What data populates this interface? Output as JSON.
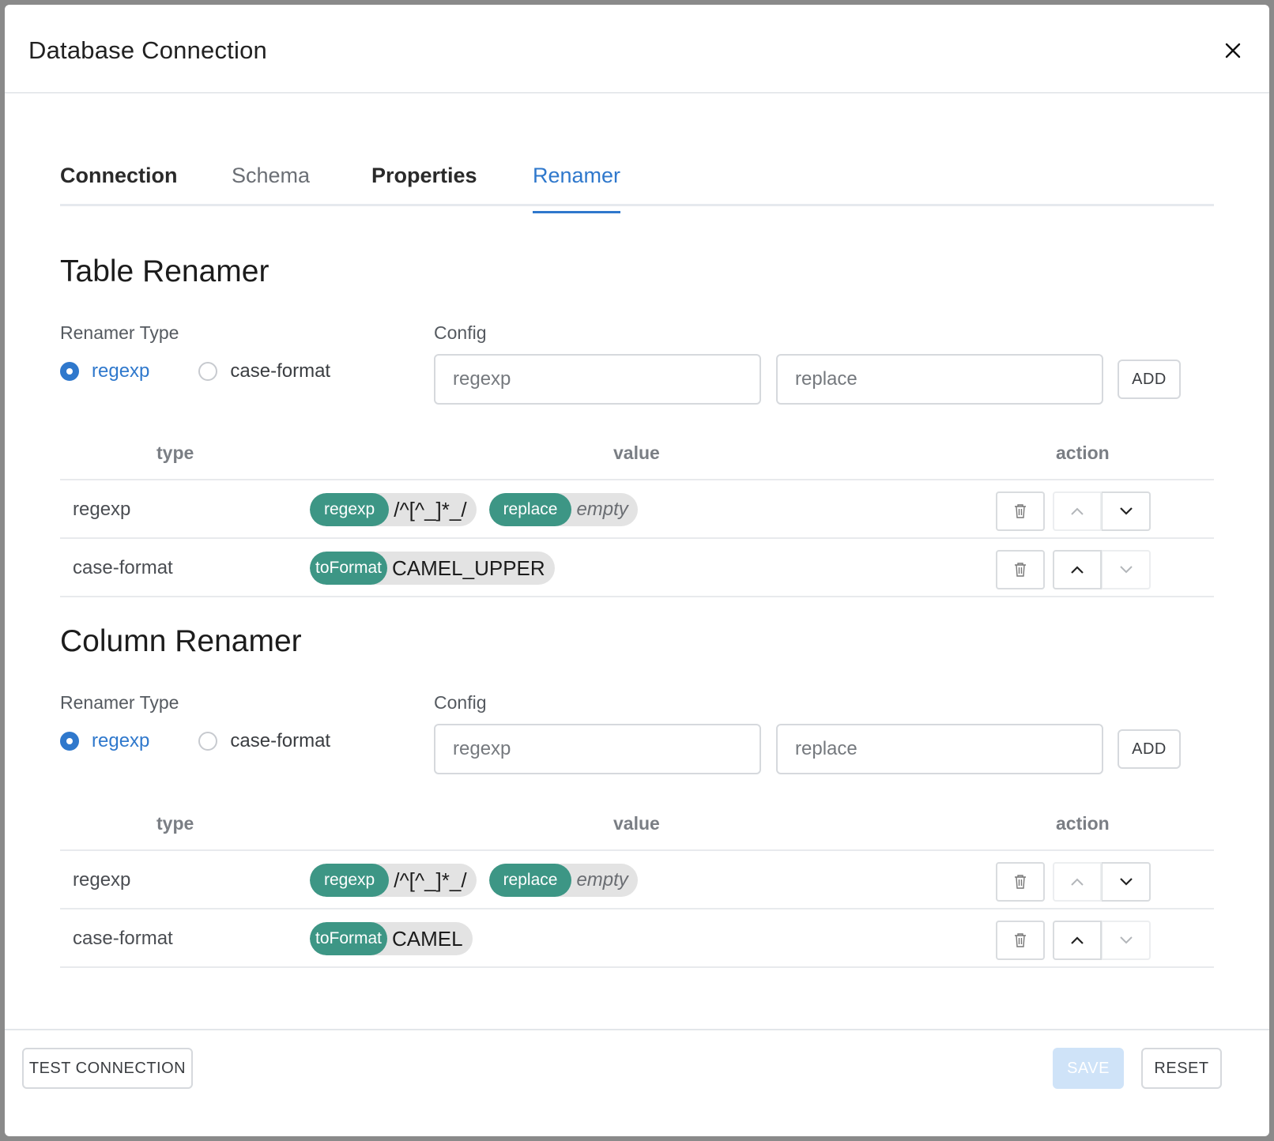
{
  "dialog": {
    "title": "Database Connection",
    "close_icon": "close-icon"
  },
  "tabs": [
    {
      "label": "Connection"
    },
    {
      "label": "Schema"
    },
    {
      "label": "Properties"
    },
    {
      "label": "Renamer"
    }
  ],
  "active_tab": "Renamer",
  "table_renamer": {
    "title": "Table Renamer",
    "renamer_type_label": "Renamer Type",
    "config_label": "Config",
    "radio_options": [
      "regexp",
      "case-format"
    ],
    "selected": "regexp",
    "regexp_placeholder": "regexp",
    "replace_placeholder": "replace",
    "add_label": "ADD",
    "columns": {
      "type": "type",
      "value": "value",
      "action": "action"
    },
    "rows": [
      {
        "type": "regexp",
        "chips": [
          {
            "key": "regexp",
            "value": "/^[^_]*_/"
          },
          {
            "key": "replace",
            "value": "empty"
          }
        ]
      },
      {
        "type": "case-format",
        "chips": [
          {
            "key": "toFormat",
            "value": "CAMEL_UPPER"
          }
        ]
      }
    ]
  },
  "column_renamer": {
    "title": "Column Renamer",
    "renamer_type_label": "Renamer Type",
    "config_label": "Config",
    "radio_options": [
      "regexp",
      "case-format"
    ],
    "selected": "regexp",
    "regexp_placeholder": "regexp",
    "replace_placeholder": "replace",
    "add_label": "ADD",
    "columns": {
      "type": "type",
      "value": "value",
      "action": "action"
    },
    "rows": [
      {
        "type": "regexp",
        "chips": [
          {
            "key": "regexp",
            "value": "/^[^_]*_/"
          },
          {
            "key": "replace",
            "value": "empty"
          }
        ]
      },
      {
        "type": "case-format",
        "chips": [
          {
            "key": "toFormat",
            "value": "CAMEL"
          }
        ]
      }
    ]
  },
  "footer": {
    "test_connection_label": "TEST CONNECTION",
    "save_label": "SAVE",
    "reset_label": "RESET"
  },
  "colors": {
    "accent": "#2f78cc",
    "chip_key": "#3d9685",
    "chip_bg": "#e3e3e3",
    "save_disabled": "#cfe3f8"
  },
  "icons": {
    "delete": "trash-icon",
    "up": "chevron-up-icon",
    "down": "chevron-down-icon"
  }
}
